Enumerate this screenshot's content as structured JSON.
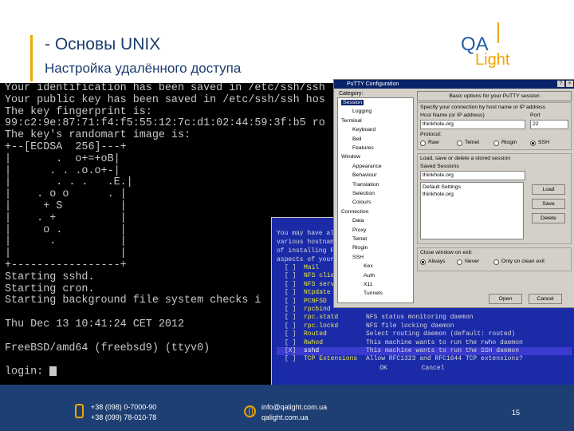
{
  "slide": {
    "title": "- Основы UNIX",
    "subtitle": "Настройка удалённого доступа",
    "logo_top": "QA",
    "logo_bottom": "Light",
    "accent_color": "#f0a500",
    "brand_color": "#1e3f73"
  },
  "terminal": {
    "lines": [
      "Your identification has been saved in /etc/ssh/ssh",
      "Your public key has been saved in /etc/ssh/ssh hos",
      "The key fingerprint is:",
      "99:c2:9e:87:71:f4:f5:55:12:7c:d1:02:44:59:3f:b5 ro",
      "The key's randomart image is:",
      "+--[ECDSA  256]---+",
      "|       .  o+=+oB|",
      "|      . . .o.o+-|",
      "|       . . .   .E.|",
      "|    . o o      . |",
      "|     + S         |",
      "|    . +          |",
      "|     o .         |",
      "|      .          |",
      "|                 |",
      "+-----------------+",
      "Starting sshd.",
      "Starting cron.",
      "Starting background file system checks i",
      "",
      "Thu Dec 13 10:41:24 CET 2012",
      "",
      "FreeBSD/amd64 (freebsd9) (ttyv0)",
      "",
      "login: "
    ]
  },
  "sysinstall": {
    "intro_lines": [
      "You may have al",
      "various hostnam",
      "of installing F",
      "aspects of your"
    ],
    "items": [
      {
        "check": "[ ]",
        "name": "Mail",
        "desc": ""
      },
      {
        "check": "[ ]",
        "name": "NFS clie",
        "desc": ""
      },
      {
        "check": "[ ]",
        "name": "NFS serv",
        "desc": ""
      },
      {
        "check": "[ ]",
        "name": "Ntpdate",
        "desc": ""
      },
      {
        "check": "[ ]",
        "name": "PCNFSD",
        "desc": ""
      },
      {
        "check": "[ ]",
        "name": "rpcbind",
        "desc": ""
      },
      {
        "check": "[ ]",
        "name": "rpc.statd",
        "desc": "NFS status monitoring daemon"
      },
      {
        "check": "[ ]",
        "name": "rpc.lockd",
        "desc": "NFS file locking daemon"
      },
      {
        "check": "[ ]",
        "name": "Routed",
        "desc": "Select routing daemon (default: routed)"
      },
      {
        "check": "[ ]",
        "name": "Rwhod",
        "desc": "This machine wants to run the rwho daemon"
      },
      {
        "check": "[X]",
        "name": "sshd",
        "desc": "This machine wants to run the SSH daemon"
      },
      {
        "check": "[ ]",
        "name": "TCP Extensions",
        "desc": "Allow RFC1323 and RFC1644 TCP extensions?"
      }
    ],
    "ok_label": "OK",
    "cancel_label": "Cancel"
  },
  "putty": {
    "title": "PuTTY Configuration",
    "category_label": "Category:",
    "tree": [
      {
        "label": "Session",
        "depth": 0,
        "selected": true
      },
      {
        "label": "Logging",
        "depth": 1
      },
      {
        "label": "Terminal",
        "depth": 0
      },
      {
        "label": "Keyboard",
        "depth": 1
      },
      {
        "label": "Bell",
        "depth": 1
      },
      {
        "label": "Features",
        "depth": 1
      },
      {
        "label": "Window",
        "depth": 0
      },
      {
        "label": "Appearance",
        "depth": 1
      },
      {
        "label": "Behaviour",
        "depth": 1
      },
      {
        "label": "Translation",
        "depth": 1
      },
      {
        "label": "Selection",
        "depth": 1
      },
      {
        "label": "Colours",
        "depth": 1
      },
      {
        "label": "Connection",
        "depth": 0
      },
      {
        "label": "Data",
        "depth": 1
      },
      {
        "label": "Proxy",
        "depth": 1
      },
      {
        "label": "Telnet",
        "depth": 1
      },
      {
        "label": "Rlogin",
        "depth": 1
      },
      {
        "label": "SSH",
        "depth": 1
      },
      {
        "label": "Kex",
        "depth": 2
      },
      {
        "label": "Auth",
        "depth": 2
      },
      {
        "label": "X11",
        "depth": 2
      },
      {
        "label": "Tunnels",
        "depth": 2
      }
    ],
    "session_header": "Basic options for your PuTTY session",
    "dest_label": "Specify your connection by host name or IP address",
    "host_label": "Host Name (or IP address)",
    "port_label": "Port",
    "host_value": "thinkhole.org",
    "port_value": "22",
    "protocol_label": "Protocol:",
    "protocols": [
      "Raw",
      "Telnet",
      "Rlogin",
      "SSH"
    ],
    "protocol_selected": "SSH",
    "sessions_group": "Load, save or delete a stored session",
    "saved_label": "Saved Sessions",
    "saved_value": "thinkhole.org",
    "sessions_list": [
      "Default Settings",
      "thinkhole.org"
    ],
    "load_label": "Load",
    "save_label": "Save",
    "delete_label": "Delete",
    "close_label": "Close window on exit:",
    "close_options": [
      "Always",
      "Never",
      "Only on clean exit"
    ],
    "close_selected": "Always",
    "open_label": "Open",
    "cancel_label": "Cancel"
  },
  "footer": {
    "phone1": "+38 (098) 0-7000-90",
    "phone2": "+38 (099) 78-010-78",
    "email": "info@qalight.com.ua",
    "site": "qalight.com.ua",
    "page": "15"
  }
}
